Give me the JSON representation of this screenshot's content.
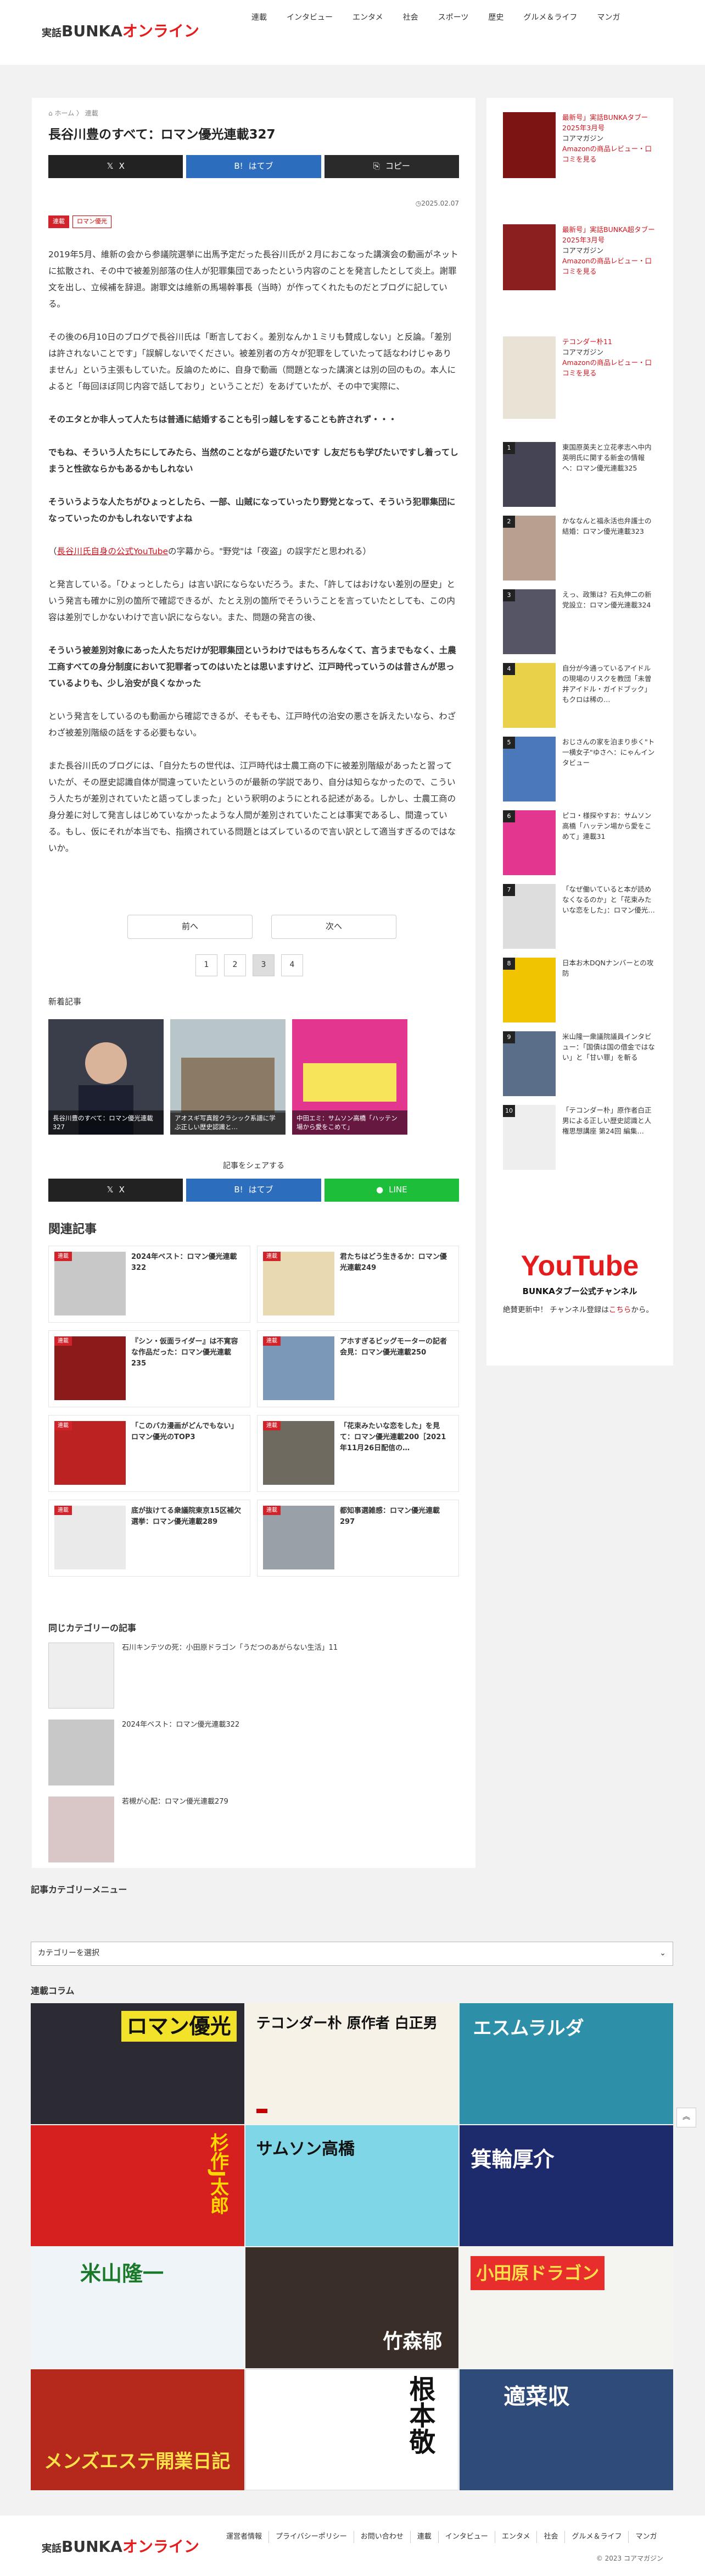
{
  "header": {
    "logo_small": "実話",
    "logo_main": "BUNKA",
    "logo_accent": "オンライン",
    "nav": [
      "連載",
      "インタビュー",
      "エンタメ",
      "社会",
      "スポーツ",
      "歴史",
      "グルメ＆ライフ",
      "マンガ"
    ]
  },
  "breadcrumb": {
    "home": "ホーム",
    "sep": "〉",
    "cat": "連載"
  },
  "article": {
    "title": "長谷川豊のすべて：ロマン優光連載327",
    "share_x": "X",
    "share_hatena": "はてブ",
    "share_copy": "コピー",
    "date": "2025.02.07",
    "cat1": "連載",
    "cat2": "ロマン優光",
    "paragraphs": [
      "2019年5月、維新の会から参議院選挙に出馬予定だった長谷川氏が２月におこなった講演会の動画がネットに拡散され、その中で被差別部落の住人が犯罪集団であったという内容のことを発言したとして炎上。謝罪文を出し、立候補を辞退。謝罪文は維新の馬場幹事長（当時）が作ってくれたものだとブログに記している。",
      "その後の6月10日のブログで長谷川氏は「断言しておく。差別なんか１ミリも賛成しない」と反論。「差別は許されないことです」「誤解しないでください。被差別者の方々が犯罪をしていたって話なわけじゃありません」という主張もしていた。反論のために、自身で動画（問題となった講演とは別の回のもの。本人によると「毎回ほぼ同じ内容で話しており」ということだ）をあげていたが、その中で実際に、"
    ],
    "quote1": "そのエタとか非人って人たちは普通に結婚することも引っ越しをすることも許されず・・・",
    "quote2": "でもね、そういう人たちにしてみたら、当然のことながら遊びたいです し友だちも学びたいですし着ってしまうと性欲ならかもあるかもしれない",
    "quote3": "そういうような人たちがひょっとしたら、一部、山賊になっていったり野党となって、そういう犯罪集団になっていったのかもしれないですよね",
    "note_link": "長谷川氏自身の公式YouTube",
    "note_rest": "の字幕から。\"野党\"は「夜盗」の誤字だと思われる）",
    "note_open": "（",
    "p3": "と発言している。「ひょっとしたら」は言い訳にならないだろう。また、「許してはおけない差別の歴史」という発言も確かに別の箇所で確認できるが、たとえ別の箇所でそういうことを言っていたとしても、この内容は差別でしかないわけで言い訳にならない。また、問題の発言の後、",
    "quote4": "そういう被差別対象にあった人たちだけが犯罪集団というわけではもちろんなくて、言うまでもなく、土農工商すべての身分制度において犯罪者ってのはいたとは思いますけど、江戸時代っていうのは昔さんが思っているよりも、少し治安が良くなかった",
    "p4": "という発言をしているのも動画から確認できるが、そもそも、江戸時代の治安の悪さを訴えたいなら、わざわざ被差別階級の話をする必要もない。",
    "p5": "また長谷川氏のブログには、「自分たちの世代は、江戸時代は士農工商の下に被差別階級があったと習っていたが、その歴史認識自体が間違っていたというのが最新の学説であり、自分は知らなかったので、こういう人たちが差別されていたと語ってしまった」という釈明のようにとれる記述がある。しかし、士農工商の身分差に対して発言しはじめていなかったような人間が差別されていたことは事実であるし、間違っている。もし、仮にそれが本当でも、指摘されている問題とはズレているので言い訳として適当すぎるのではないか。"
  },
  "pagination": {
    "prev": "前へ",
    "next": "次へ",
    "pages": [
      "1",
      "2",
      "3",
      "4"
    ]
  },
  "new_articles": {
    "heading": "新着記事",
    "items": [
      "長谷川豊のすべて：ロマン優光連載327",
      "アオスギ写真館クラシック系譜に学ぶ正しい歴史認識と…",
      "中田エミ：サムソン高橋「ハッテン場から愛をこめて」"
    ]
  },
  "share2": {
    "label": "記事をシェアする",
    "x": "X",
    "hatena": "はてブ",
    "line": "LINE"
  },
  "related": {
    "heading": "関連記事",
    "badge": "連載",
    "items": [
      "2024年ベスト：ロマン優光連載322",
      "君たちはどう生きるか：ロマン優光連載249",
      "『シン・仮面ライダー』は不寛容な作品だった：ロマン優光連載235",
      "アホすぎるビッグモーターの記者会見：ロマン優光連載250",
      "「このバカ漫画がどんでもない」ロマン優光のTOP3",
      "「花束みたいな恋をした」を見て：ロマン優光連載200［2021年11月26日配信の…",
      "底が抜けてる衆議院東京15区補欠選挙：ロマン優光連載289",
      "都知事選雑感：ロマン優光連載297"
    ]
  },
  "same_cat": {
    "heading": "同じカテゴリーの記事",
    "items": [
      "石川キンテツの死：小田原ドラゴン「うだつのあがらない生活」11",
      "2024年ベスト：ロマン優光連載322",
      "若槻が心配：ロマン優光連載279"
    ]
  },
  "sidebar": {
    "books": [
      {
        "title": "最新号」実話BUNKAタブー2025年3月号",
        "pub": "コアマガジン",
        "link": "Amazonの商品レビュー・口コミを見る"
      },
      {
        "title": "最新号」実話BUNKA超タブー2025年3月号",
        "pub": "コアマガジン",
        "link": "Amazonの商品レビュー・口コミを見る"
      },
      {
        "title": "テコンダー朴11",
        "pub": "コアマガジン",
        "link": "Amazonの商品レビュー・口コミを見る"
      }
    ],
    "ranking": [
      "東国原英夫と立花孝志へ中内英明氏に関する新金の情報へ：ロマン優光連載325",
      "かななんと福永活也弁護士の結婚：ロマン優光連載323",
      "えっ、政策は？石丸伸二の新党設立：ロマン優光連載324",
      "自分が今通っているアイドルの現場のリスクを教団「未曽井アイドル・ガイドブック」もクロは稀の…",
      "おじさんの家を泊まり歩く\"ト一横女子\"ゆさへ：にゃんインタビュー",
      "ピコ・様探やすお：サムソン高橋「ハッテン場から愛をこめて」連載31",
      "「なぜ働いていると本が読めなくなるのか」と「花束みたいな恋をした」：ロマン優光…",
      "日本お木DQNナンバーとの攻防",
      "米山隆一衆議院議員インタビュー：「国債は国の借金ではない」と「甘い罪」を斬る",
      "「テコンダー朴」原作者白正男による正しい歴史認識と人権思想講座 第24回 編集…"
    ],
    "youtube_text": "絶賛更新中！ チャンネル登録は",
    "youtube_link": "こちら",
    "youtube_end": "から。",
    "youtube_banner": "YouTube",
    "youtube_sub": "BUNKAタブー公式チャンネル"
  },
  "category_menu": {
    "heading": "記事カテゴリーメニュー",
    "select": "カテゴリーを選択"
  },
  "columns": {
    "heading": "連載コラム",
    "tiles": [
      "ロマン優光",
      "テコンダー朴 原作者 白正男",
      "エスムラルダ",
      "杉作J太郎",
      "サムソン高橋",
      "箕輪厚介",
      "米山隆一",
      "竹森郁",
      "小田原ドラゴン",
      "メンズエステ開業日記",
      "根本敬",
      "適菜収"
    ]
  },
  "footer": {
    "nav": [
      "運営者情報",
      "プライバシーポリシー",
      "お問い合わせ",
      "連載",
      "インタビュー",
      "エンタメ",
      "社会",
      "グルメ＆ライフ",
      "マンガ"
    ],
    "copyright": "© 2023 コアマガジン"
  },
  "colors": {
    "accent": "#e61c1c",
    "hatena": "#2c6ebd",
    "line": "#1dbf3a"
  }
}
